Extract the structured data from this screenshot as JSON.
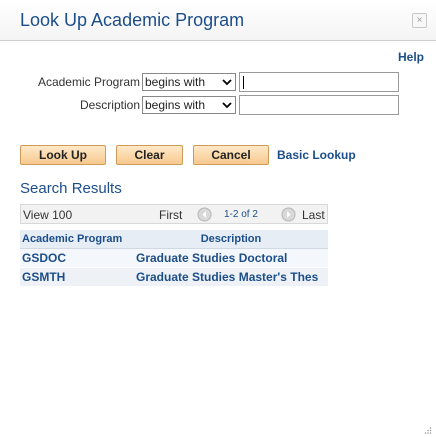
{
  "dialog": {
    "title": "Look Up Academic Program",
    "close_glyph": "×",
    "help_label": "Help"
  },
  "search": {
    "fields": [
      {
        "label": "Academic Program",
        "operator": "begins with",
        "value": ""
      },
      {
        "label": "Description",
        "operator": "begins with",
        "value": ""
      }
    ]
  },
  "buttons": {
    "look_up": "Look Up",
    "clear": "Clear",
    "cancel": "Cancel",
    "basic_lookup": "Basic Lookup"
  },
  "results": {
    "title": "Search Results",
    "view_label": "View 100",
    "first_label": "First",
    "count_label": "1-2 of 2",
    "last_label": "Last",
    "columns": [
      "Academic Program",
      "Description"
    ],
    "rows": [
      [
        "GSDOC",
        "Graduate Studies Doctoral"
      ],
      [
        "GSMTH",
        "Graduate Studies Master's Thes"
      ]
    ]
  },
  "colors": {
    "link": "#1c4e8a",
    "button_fill": "#f6c98f",
    "header_fill": "#e6edf5"
  },
  "icons": [
    "close-icon",
    "chevron-down-icon",
    "prev-arrow-icon",
    "next-arrow-icon",
    "resize-grip-icon"
  ]
}
